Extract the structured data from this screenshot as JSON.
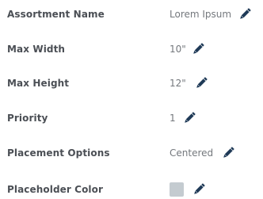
{
  "properties": [
    {
      "label": "Assortment Name",
      "value": "Lorem Ipsum"
    },
    {
      "label": "Max Width",
      "value": "10\""
    },
    {
      "label": "Max Height",
      "value": "12\""
    },
    {
      "label": "Priority",
      "value": "1"
    },
    {
      "label": "Placement Options",
      "value": "Centered"
    },
    {
      "label": "Placeholder Color",
      "swatch_color": "#c4cbd0"
    }
  ],
  "icons": {
    "edit": "pencil-icon"
  },
  "colors": {
    "pencil": "#1f3a57",
    "label": "#4b4f55",
    "value": "#74787d"
  }
}
